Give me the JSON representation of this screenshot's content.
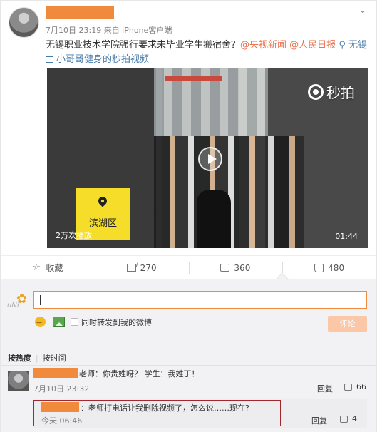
{
  "post": {
    "meta": "7月10日 23:19 来自 iPhone客户端",
    "text_main": "无锡职业技术学院强行要求未毕业学生搬宿舍？",
    "mention1": "@央视新闻",
    "mention2": "@人民日报",
    "location": "无锡",
    "topic": "小哥哥健身的秒拍视频"
  },
  "video": {
    "brand": "秒拍",
    "location_tag": "滨湖区",
    "views": "2万次播放",
    "duration": "01:44"
  },
  "actions": {
    "favorite_label": "收藏",
    "share_count": "270",
    "comment_count": "360",
    "like_count": "480"
  },
  "composer": {
    "avatar_sig": "uNi",
    "also_repost_label": "同时转发到我的微博",
    "submit_label": "评论"
  },
  "sort": {
    "hot": "按热度",
    "time": "按时间"
  },
  "comments": [
    {
      "text": "老师：你贵姓呀？ 学生：我姓丁！",
      "time": "7月10日 23:32",
      "reply": "回复",
      "likes": "66"
    },
    {
      "text": "：老师打电话让我删除视频了，怎么说……现在?",
      "time": "今天 06:46",
      "reply": "回复",
      "likes": "4"
    }
  ],
  "colors": {
    "accent_orange": "#eb7350",
    "link_blue": "#4a7ba8",
    "redact_orange": "#f08a3c",
    "highlight_border": "#a0282f"
  }
}
